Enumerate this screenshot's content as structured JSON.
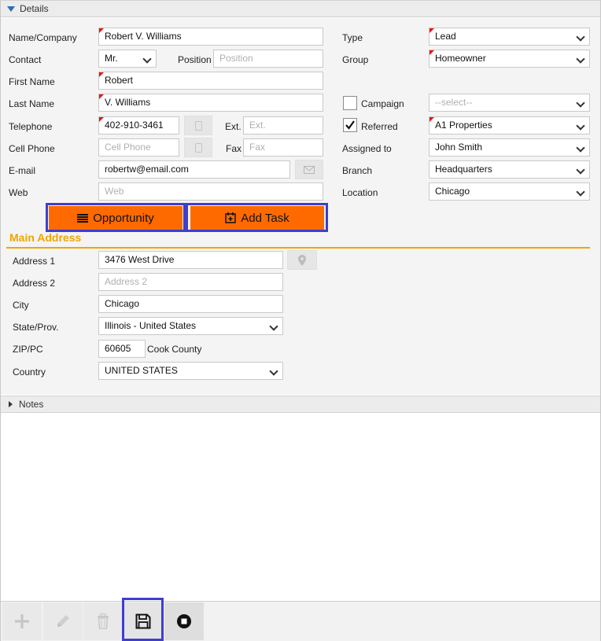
{
  "details": {
    "section_title": "Details",
    "labels": {
      "name_company": "Name/Company",
      "contact": "Contact",
      "position": "Position",
      "first_name": "First Name",
      "last_name": "Last Name",
      "telephone": "Telephone",
      "ext": "Ext.",
      "cell_phone": "Cell Phone",
      "fax": "Fax",
      "email": "E-mail",
      "web": "Web",
      "type": "Type",
      "group": "Group",
      "campaign": "Campaign",
      "referred": "Referred",
      "assigned_to": "Assigned to",
      "branch": "Branch",
      "location": "Location"
    },
    "values": {
      "name_company": "Robert V. Williams",
      "salutation": "Mr.",
      "first_name": "Robert",
      "last_name": "V. Williams",
      "telephone": "402-910-3461",
      "email": "robertw@email.com",
      "type": "Lead",
      "group": "Homeowner",
      "referred": "A1 Properties",
      "assigned_to": "John Smith",
      "branch": "Headquarters",
      "location": "Chicago"
    },
    "placeholders": {
      "position": "Position",
      "ext": "Ext.",
      "cell_phone": "Cell Phone",
      "fax": "Fax",
      "web": "Web",
      "campaign": "--select--"
    },
    "campaign_checked": false,
    "referred_checked": true,
    "buttons": {
      "opportunity": "Opportunity",
      "add_task": "Add Task"
    }
  },
  "main_address": {
    "title": "Main Address",
    "labels": {
      "address1": "Address 1",
      "address2": "Address 2",
      "city": "City",
      "state": "State/Prov.",
      "zip": "ZIP/PC",
      "country": "Country"
    },
    "values": {
      "address1": "3476 West Drive",
      "city": "Chicago",
      "state": "Illinois - United States",
      "zip": "60605",
      "county": "Cook County",
      "country": "UNITED STATES"
    },
    "placeholders": {
      "address2": "Address 2"
    }
  },
  "notes": {
    "section_title": "Notes"
  },
  "colors": {
    "accent_orange": "#ff6a00",
    "section_title": "#f0a500",
    "highlight": "#3e3ecf",
    "required_marker": "#e11111"
  },
  "toolbar": {
    "icons": [
      "plus-icon",
      "pencil-icon",
      "trash-icon",
      "save-icon",
      "stop-icon"
    ]
  }
}
